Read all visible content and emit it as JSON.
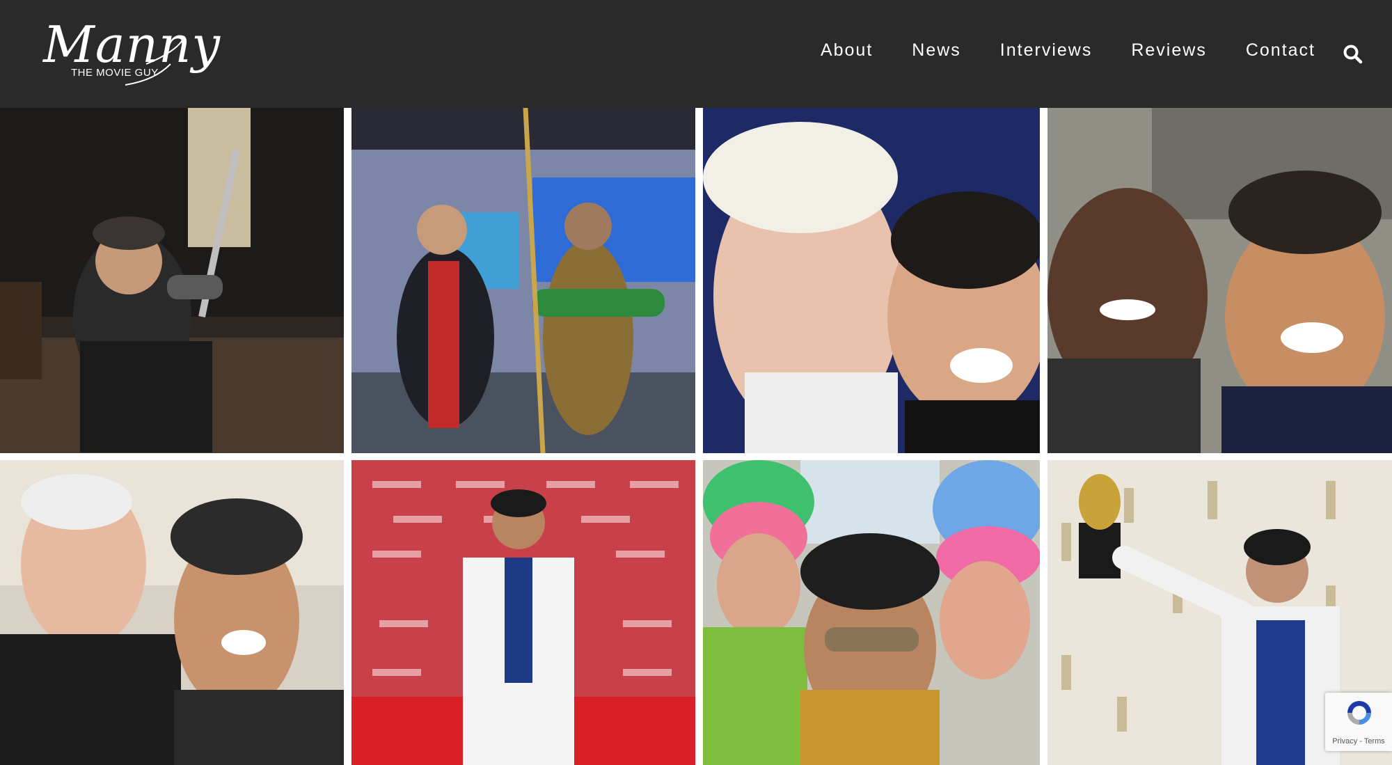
{
  "site": {
    "logo_script": "Manny",
    "logo_sub": "THE MOVIE GUY"
  },
  "nav": {
    "items": [
      "About",
      "News",
      "Interviews",
      "Reviews",
      "Contact"
    ]
  },
  "search": {
    "icon": "search-icon"
  },
  "recaptcha": {
    "privacy": "Privacy",
    "separator": "-",
    "terms": "Terms"
  },
  "colors": {
    "header_bg": "#2a2a2a",
    "nav_text": "#ffffff"
  }
}
